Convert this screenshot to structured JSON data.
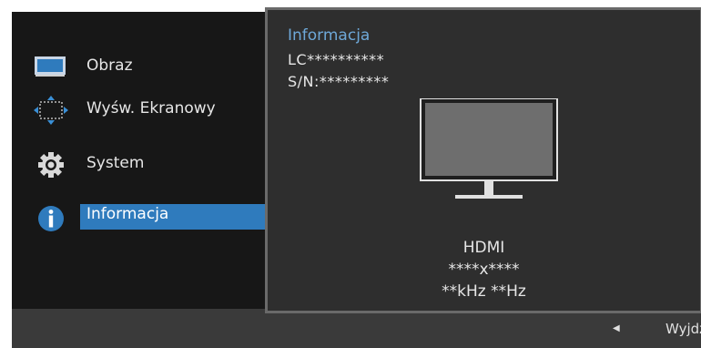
{
  "menu": {
    "items": [
      {
        "label": "Obraz",
        "icon": "monitor-icon"
      },
      {
        "label": "Wyśw. Ekranowy",
        "icon": "move-arrows-icon"
      },
      {
        "label": "System",
        "icon": "gear-icon"
      },
      {
        "label": "Informacja",
        "icon": "info-icon",
        "selected": true
      }
    ]
  },
  "info": {
    "title": "Informacja",
    "model": "LC**********",
    "serial": "S/N:*********",
    "source": "HDMI",
    "resolution": "****x****",
    "frequency": "**kHz **Hz"
  },
  "footer": {
    "exit_icon": "left-arrow-icon",
    "exit_label": "Wyjdź"
  },
  "colors": {
    "accent": "#2f7bbd",
    "title": "#6ea8d8",
    "menu_bg": "#171717",
    "panel_bg": "#2e2e2e",
    "panel_border": "#6a6a6a"
  }
}
